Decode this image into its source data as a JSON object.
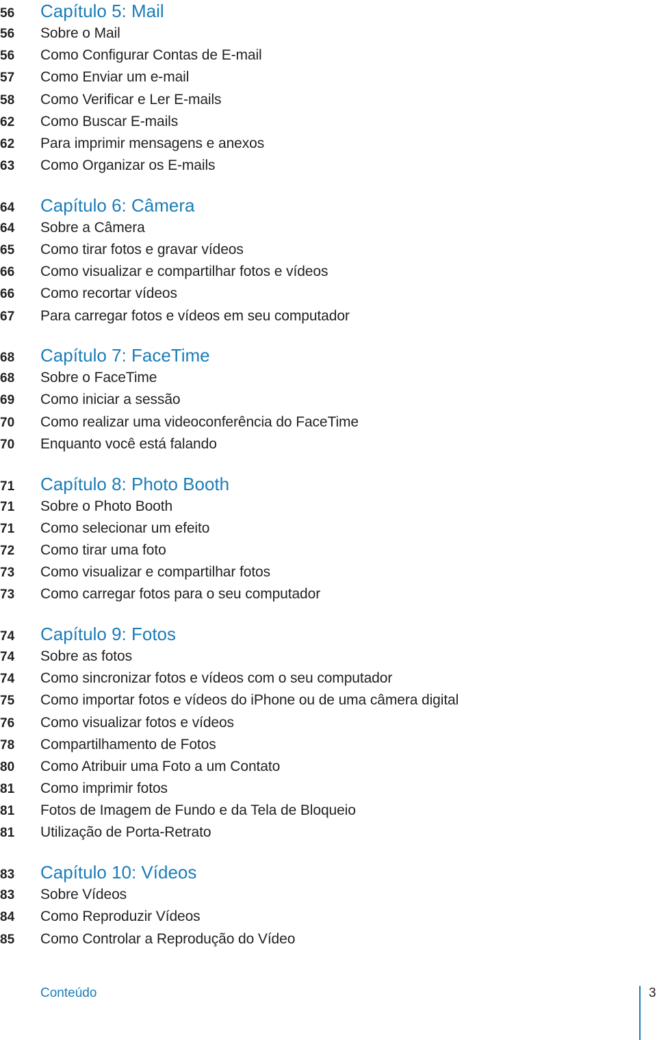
{
  "toc": {
    "chapters": [
      {
        "page": "56",
        "title": "Capítulo 5: Mail",
        "entries": [
          {
            "page": "56",
            "title": "Sobre o Mail"
          },
          {
            "page": "56",
            "title": "Como Configurar Contas de E-mail"
          },
          {
            "page": "57",
            "title": "Como Enviar um e-mail"
          },
          {
            "page": "58",
            "title": "Como Verificar e Ler E-mails"
          },
          {
            "page": "62",
            "title": "Como Buscar E-mails"
          },
          {
            "page": "62",
            "title": "Para imprimir mensagens e anexos"
          },
          {
            "page": "63",
            "title": "Como Organizar os E-mails"
          }
        ]
      },
      {
        "page": "64",
        "title": "Capítulo 6: Câmera",
        "entries": [
          {
            "page": "64",
            "title": "Sobre a Câmera"
          },
          {
            "page": "65",
            "title": "Como tirar fotos e gravar vídeos"
          },
          {
            "page": "66",
            "title": "Como visualizar e compartilhar fotos e vídeos"
          },
          {
            "page": "66",
            "title": "Como recortar vídeos"
          },
          {
            "page": "67",
            "title": "Para carregar fotos e vídeos em seu computador"
          }
        ]
      },
      {
        "page": "68",
        "title": "Capítulo 7: FaceTime",
        "entries": [
          {
            "page": "68",
            "title": "Sobre o FaceTime"
          },
          {
            "page": "69",
            "title": "Como iniciar a sessão"
          },
          {
            "page": "70",
            "title": "Como realizar uma videoconferência do FaceTime"
          },
          {
            "page": "70",
            "title": "Enquanto você está falando"
          }
        ]
      },
      {
        "page": "71",
        "title": "Capítulo 8: Photo Booth",
        "entries": [
          {
            "page": "71",
            "title": "Sobre o Photo Booth"
          },
          {
            "page": "71",
            "title": "Como selecionar um efeito"
          },
          {
            "page": "72",
            "title": "Como tirar uma foto"
          },
          {
            "page": "73",
            "title": "Como visualizar e compartilhar fotos"
          },
          {
            "page": "73",
            "title": "Como carregar fotos para o seu computador"
          }
        ]
      },
      {
        "page": "74",
        "title": "Capítulo 9: Fotos",
        "entries": [
          {
            "page": "74",
            "title": "Sobre as fotos"
          },
          {
            "page": "74",
            "title": "Como sincronizar fotos e vídeos com o seu computador"
          },
          {
            "page": "75",
            "title": "Como importar fotos e vídeos do iPhone ou de uma câmera digital"
          },
          {
            "page": "76",
            "title": "Como visualizar fotos e vídeos"
          },
          {
            "page": "78",
            "title": "Compartilhamento de Fotos"
          },
          {
            "page": "80",
            "title": "Como Atribuir uma Foto a um Contato"
          },
          {
            "page": "81",
            "title": "Como imprimir fotos"
          },
          {
            "page": "81",
            "title": "Fotos de Imagem de Fundo e da Tela de Bloqueio"
          },
          {
            "page": "81",
            "title": "Utilização de Porta-Retrato"
          }
        ]
      },
      {
        "page": "83",
        "title": "Capítulo 10: Vídeos",
        "entries": [
          {
            "page": "83",
            "title": "Sobre Vídeos"
          },
          {
            "page": "84",
            "title": "Como Reproduzir Vídeos"
          },
          {
            "page": "85",
            "title": "Como Controlar a Reprodução do Vídeo"
          }
        ]
      }
    ]
  },
  "footer": {
    "section_label": "Conteúdo",
    "page_number": "3"
  },
  "colors": {
    "accent": "#1a7cb8",
    "text": "#231f20"
  }
}
